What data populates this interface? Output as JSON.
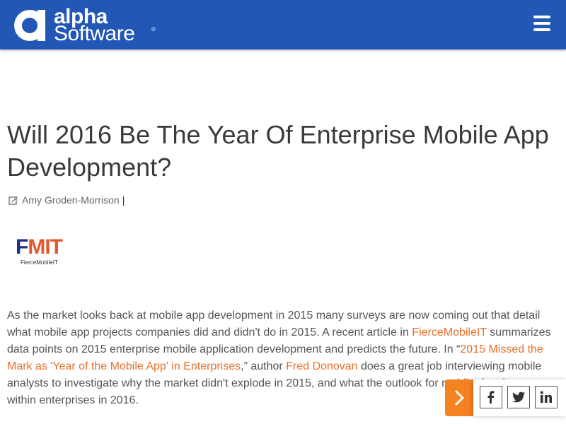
{
  "header": {
    "brand_line1": "alpha",
    "brand_line2": "Software",
    "brand_reg": "®",
    "menu_icon": "hamburger-menu-icon",
    "background": "#2257b5"
  },
  "article": {
    "title": "Will 2016 Be The Year Of Enterprise Mobile App Development?",
    "author_icon": "edit-icon",
    "author": "Amy Groden-Morrison",
    "separator": "|",
    "source_logo_mark_f": "F",
    "source_logo_mark_mit": "MIT",
    "source_logo_sub": "FierceMobileIT",
    "paragraph": {
      "p1": "As the market looks back at mobile app development in 2015 many surveys are now coming out that detail what mobile app projects companies did and didn't do in 2015.  A recent article in ",
      "link1": "FierceMobileIT",
      "p2": " summarizes data points on 2015 enterprise mobile application development and predicts the future. In “",
      "link2": "2015 Missed the Mark as 'Year of the Mobile App' in Enterprises",
      "p3": ",” author ",
      "link3": "Fred Donovan",
      "p4": " does a great job interviewing mobile analysts to investigate why the market didn't explode in 2015, and what the outlook for mobile development within enterprises in 2016."
    },
    "link_color": "#e8702a"
  },
  "share": {
    "toggle_icon": "chevron-right-icon",
    "facebook_icon": "facebook-icon",
    "twitter_icon": "twitter-icon",
    "linkedin_icon": "linkedin-icon",
    "accent": "#f58220"
  }
}
